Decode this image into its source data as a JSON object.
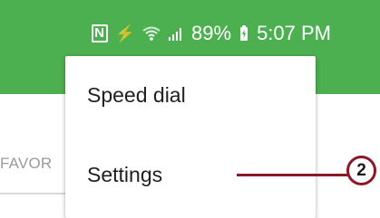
{
  "status_bar": {
    "battery_percent": "89%",
    "time": "5:07 PM"
  },
  "background_tab": {
    "label": "FAVOR"
  },
  "overflow_menu": {
    "items": [
      {
        "label": "Speed dial"
      },
      {
        "label": "Settings"
      }
    ]
  },
  "callout": {
    "number": "2"
  },
  "colors": {
    "app_bar": "#4caf50",
    "callout": "#8b1727"
  }
}
